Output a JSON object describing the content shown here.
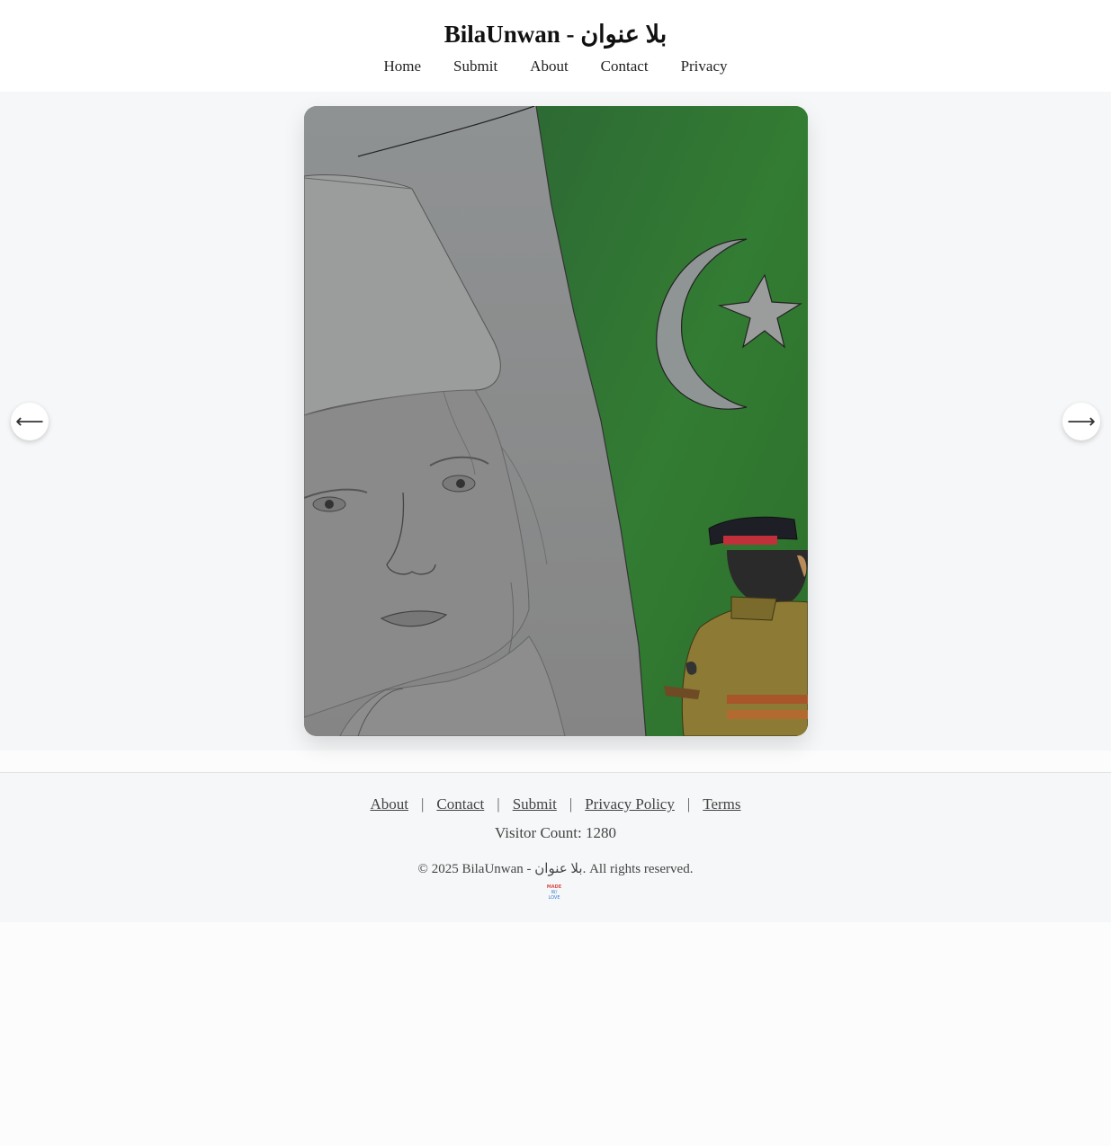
{
  "site": {
    "title": "BilaUnwan - بلا عنوان"
  },
  "nav": {
    "items": [
      "Home",
      "Submit",
      "About",
      "Contact",
      "Privacy"
    ]
  },
  "gallery": {
    "prev_arrow": "⟵",
    "next_arrow": "⟶"
  },
  "footer": {
    "links": [
      "About",
      "Contact",
      "Submit",
      "Privacy Policy",
      "Terms"
    ],
    "separator": "|",
    "visitor_count": "Visitor Count: 1280",
    "copyright": "© 2025 BilaUnwan - بلا عنوان. All rights reserved.",
    "badge_line1": "MADE",
    "badge_line2": "W/ LOVE"
  },
  "colors": {
    "flag_green": "#2f7a2f",
    "flag_white": "#e6e6e6",
    "paper_gray": "#8e8e8e",
    "uniform_khaki": "#8a7a3a",
    "cap_red": "#c0303a"
  }
}
